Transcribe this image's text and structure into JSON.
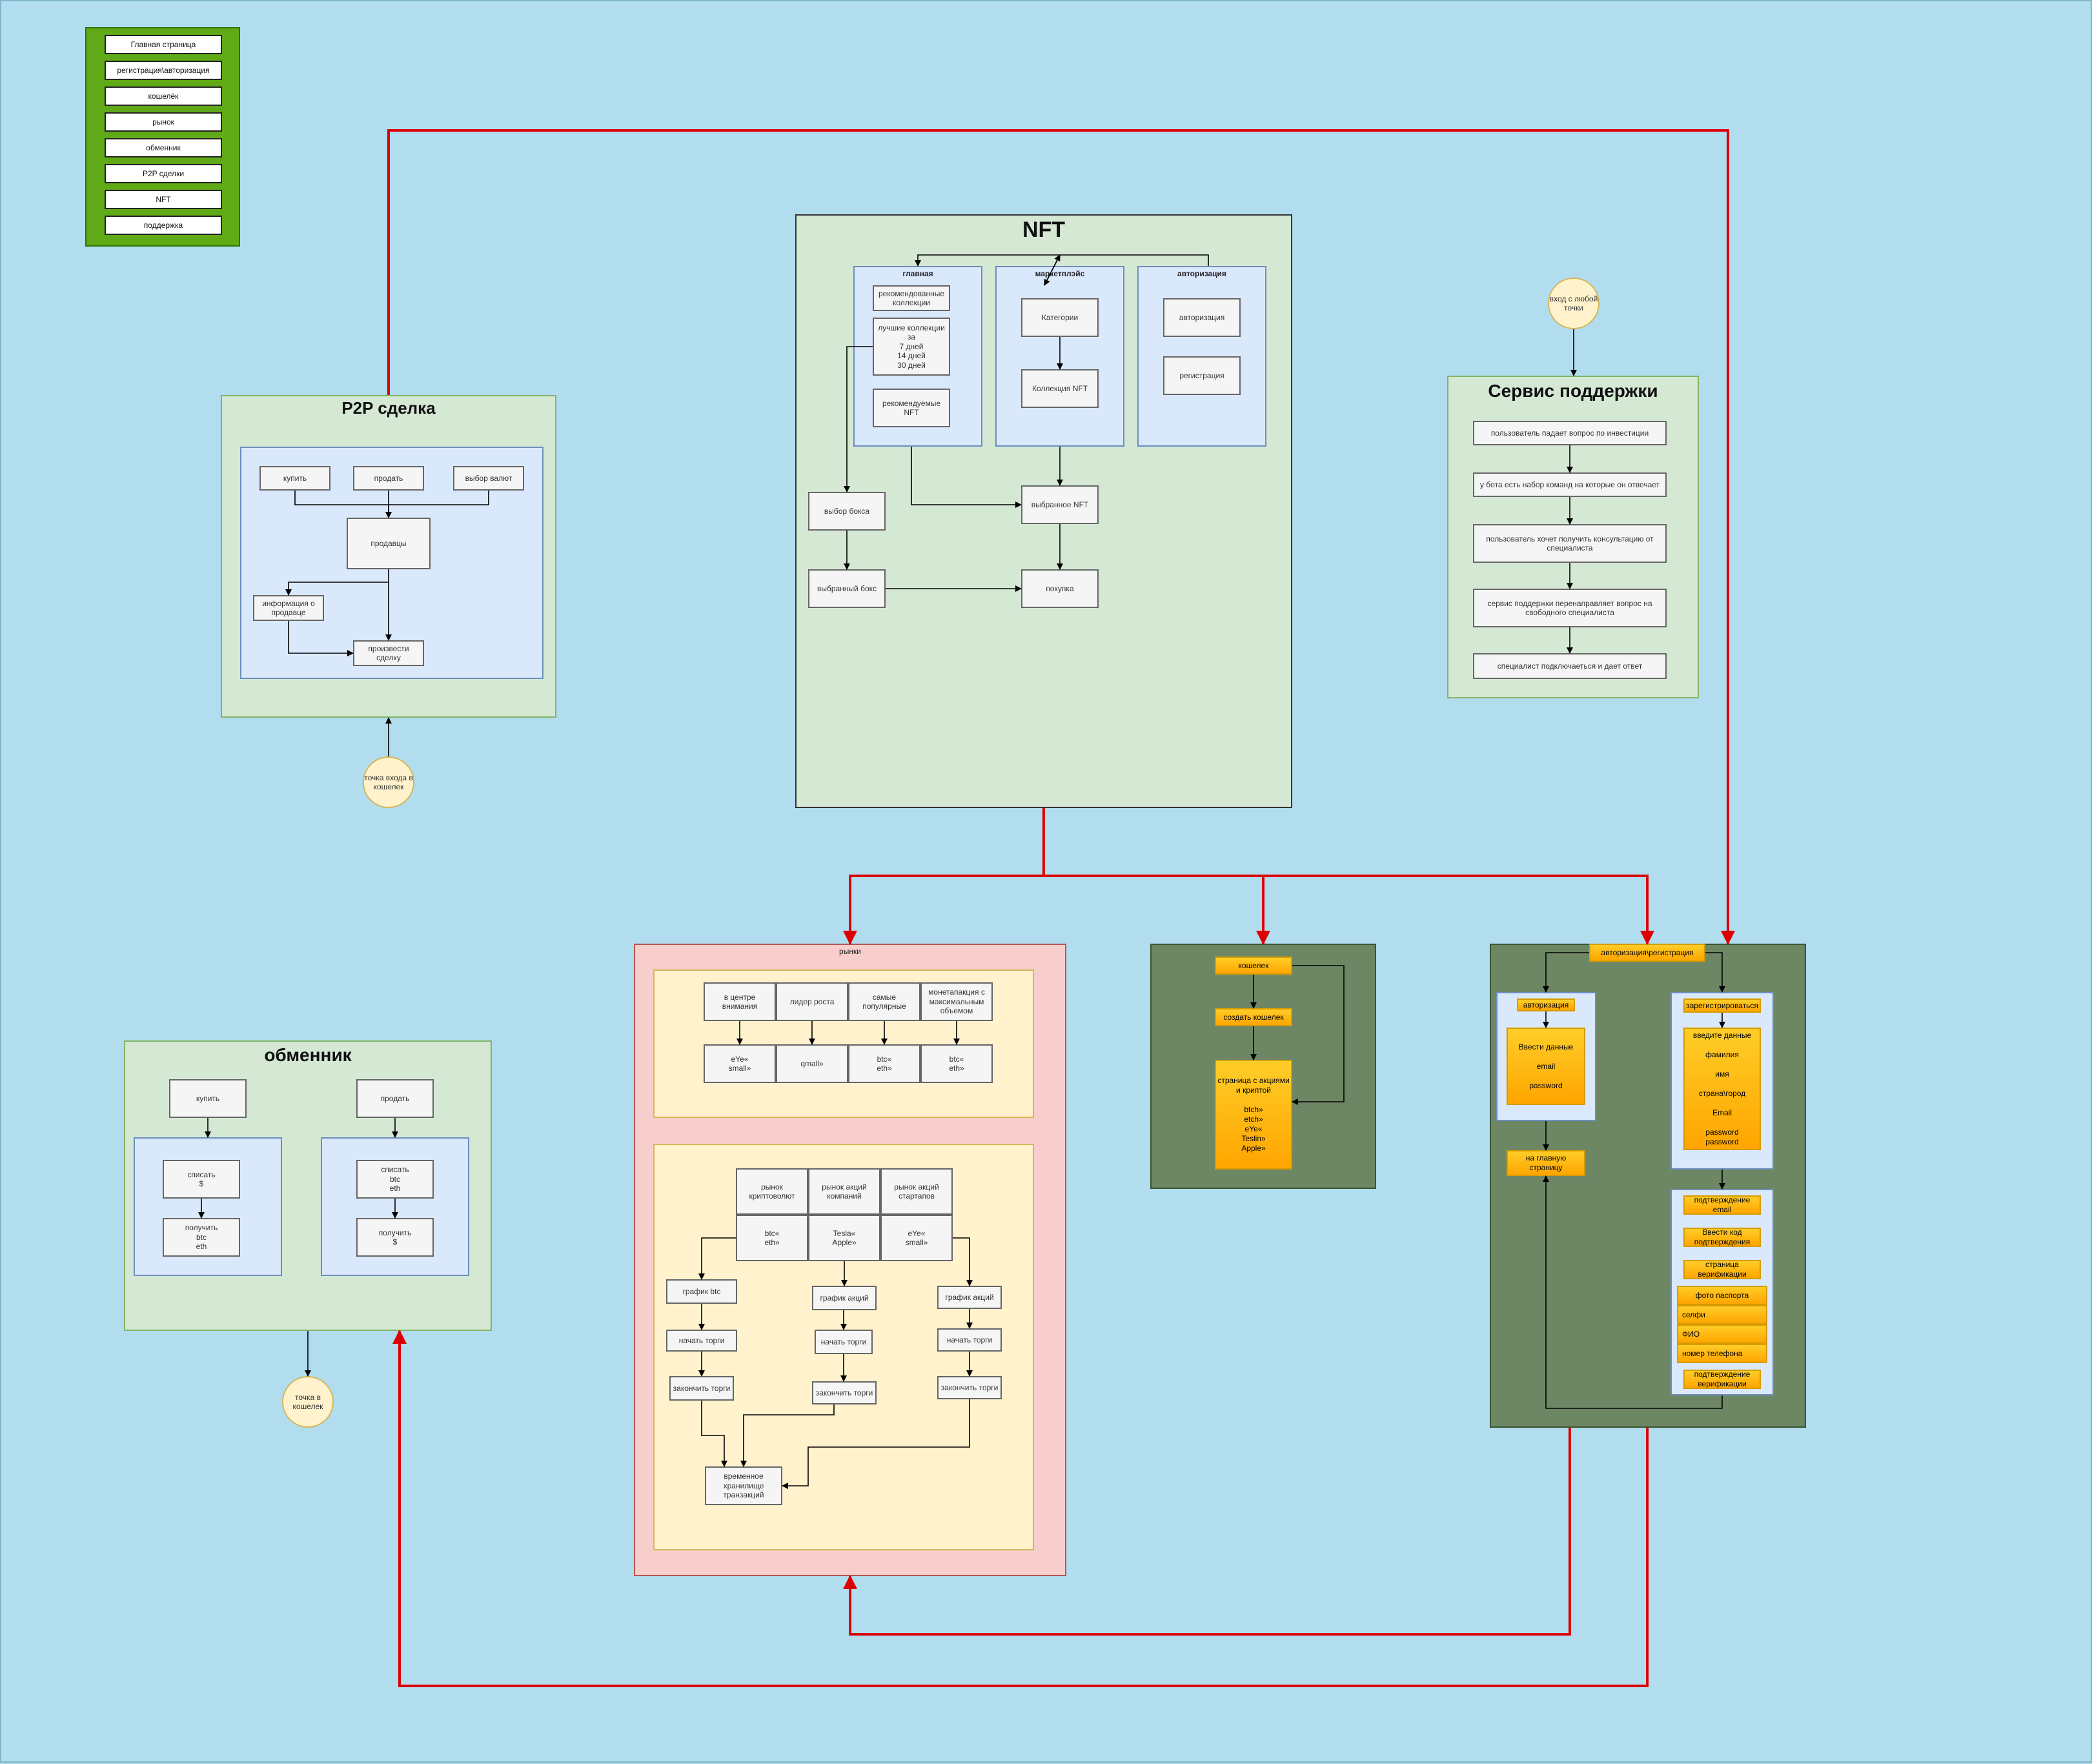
{
  "menu": {
    "items": [
      "Главная страница",
      "регистрация\\авторизация",
      "кошелёк",
      "рынок",
      "обменник",
      "P2P сделки",
      "NFT",
      "поддержка"
    ]
  },
  "p2p": {
    "title": "P2P сделка",
    "buy": "купить",
    "sell": "продать",
    "currency": "выбор валют",
    "sellers": "продавцы",
    "seller_info": "информация о\nпродавце",
    "deal": "произвести сделку",
    "entry": "точка входа в\nкошелек"
  },
  "nft": {
    "title": "NFT",
    "main": {
      "title": "главная",
      "recommended_collections": "рекомендованные\nколлекции",
      "best_collections": "лучшие коллекции\nза\n7 дней\n14 дней\n30 дней",
      "recommended_nft": "рекомендуемые NFT"
    },
    "marketplace": {
      "title": "маркетплэйс",
      "categories": "Категории",
      "collection": "Коллекция NFT"
    },
    "auth": {
      "title": "авторизация",
      "login": "авторизация",
      "register": "регистрация"
    },
    "box_choice": "выбор бокса",
    "chosen_box": "выбранный бокс",
    "chosen_nft": "выбранное NFT",
    "purchase": "покупка"
  },
  "support": {
    "title": "Сервис поддержки",
    "entry": "вход с любой\nточки",
    "steps": [
      "пользователь падает вопрос  по инвестиции",
      "у бота есть набор команд на которые  он отвечает",
      "пользователь хочет  получить консультацию от\nспециалиста",
      "сервис поддержки  перенаправляет вопрос на\nсвободного специалиста",
      "специалист подключаеться  и дает ответ"
    ]
  },
  "markets": {
    "title": "рынки",
    "top_headers": [
      "в центре внимания",
      "лидер роста",
      "самые популярные",
      "монетапакция с\nмаксимальным\nобъемом"
    ],
    "top_values": [
      "eYe«\nsmall»",
      "qmall»",
      "btc«\neth»",
      "btc«\neth»"
    ],
    "bottom_headers": [
      "рынок криптоволют",
      "рынок акций\nкомпаний",
      "рынок акций\nстартапов"
    ],
    "bottom_values": [
      "btc«\neth»",
      "Tesla«\nApple»",
      "eYe«\nsmall»"
    ],
    "charts": [
      "график  btc",
      "график акций",
      "график акций"
    ],
    "start": [
      "начать торги",
      "начать торги",
      "начать торги"
    ],
    "finish": [
      "закончить торги",
      "закончить торги",
      "закончить торги"
    ],
    "storage": "временное\nхранилище\nтранзакций"
  },
  "wallet": {
    "wallet": "кошелек",
    "create": "создать кошелек",
    "page": "страница с акциями\nи криптой\n\nbtch»\netch»\neYe«\nTeslin»\nApple»"
  },
  "authreg": {
    "header": "авторизация\\регистрация",
    "login": "авторизация",
    "login_fields": "Ввести данные\n\nemail\n\npassword",
    "to_main": "на главную страницу",
    "register": "зарегистрироваться",
    "register_fields": "введите данные\n\nфамилия\n\nимя\n\nстрана\\город\n\nEmail\n\npassword\npassword",
    "confirm_email": "подтверждение\nemail",
    "enter_code": "Ввести код\nподтверждения",
    "verification_page": "страница\nверификации",
    "passport": "фото паспорта",
    "selfie": "селфи",
    "fio": "ФИО",
    "phone": "номер телефона",
    "confirm_verification": "подтверждение\nверификации"
  },
  "exchange": {
    "title": "обменник",
    "buy": "купить",
    "sell": "продать",
    "debit_usd": "списать\n$",
    "get_crypto": "получить\nbtc\neth",
    "debit_crypto": "списать\nbtc\neth",
    "get_usd": "получить\n$",
    "entry": "точка в\nкошелек"
  },
  "colors": {
    "red_link": "#dd0000",
    "menu_bg": "#60a917"
  }
}
